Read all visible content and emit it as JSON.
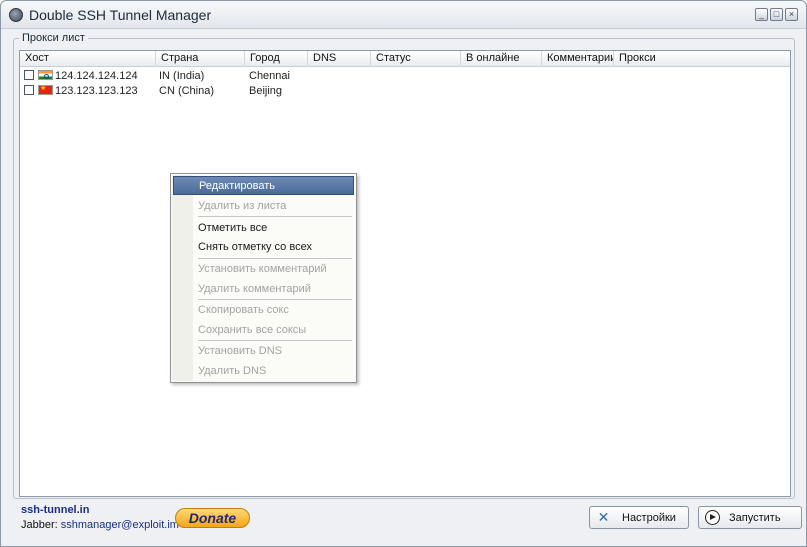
{
  "window": {
    "title": "Double SSH Tunnel Manager",
    "min_label": "_",
    "max_label": "□",
    "close_label": "×"
  },
  "group": {
    "legend": "Прокси лист"
  },
  "columns": [
    "Хост",
    "Страна",
    "Город",
    "DNS",
    "Статус",
    "В онлайне",
    "Комментарии",
    "Прокси"
  ],
  "rows": [
    {
      "host": "124.124.124.124",
      "country": "IN (India)",
      "city": "Chennai",
      "flag": "india-flag-icon",
      "checked": false
    },
    {
      "host": "123.123.123.123",
      "country": "CN (China)",
      "city": "Beijing",
      "flag": "china-flag-icon",
      "checked": false
    }
  ],
  "context_menu": {
    "items": [
      {
        "label": "Редактировать",
        "enabled": true,
        "selected": true
      },
      {
        "label": "Удалить из листа",
        "enabled": false
      },
      {
        "label": "Отметить все",
        "enabled": true
      },
      {
        "label": "Снять отметку со всех",
        "enabled": true
      },
      {
        "label": "Установить комментарий",
        "enabled": false
      },
      {
        "label": "Удалить комментарий",
        "enabled": false
      },
      {
        "label": "Скопировать сокс",
        "enabled": false
      },
      {
        "label": "Сохранить все соксы",
        "enabled": false
      },
      {
        "label": "Установить DNS",
        "enabled": false
      },
      {
        "label": "Удалить DNS",
        "enabled": false
      }
    ]
  },
  "footer": {
    "site": "ssh-tunnel.in",
    "jabber_label": "Jabber:",
    "jabber_address": "sshmanager@exploit.im",
    "donate_label": "Donate",
    "settings_label": "Настройки",
    "start_label": "Запустить"
  },
  "colors": {
    "menu_highlight": "#4a6a9a",
    "link": "#1a2f8a",
    "donate": "#f6a517"
  }
}
